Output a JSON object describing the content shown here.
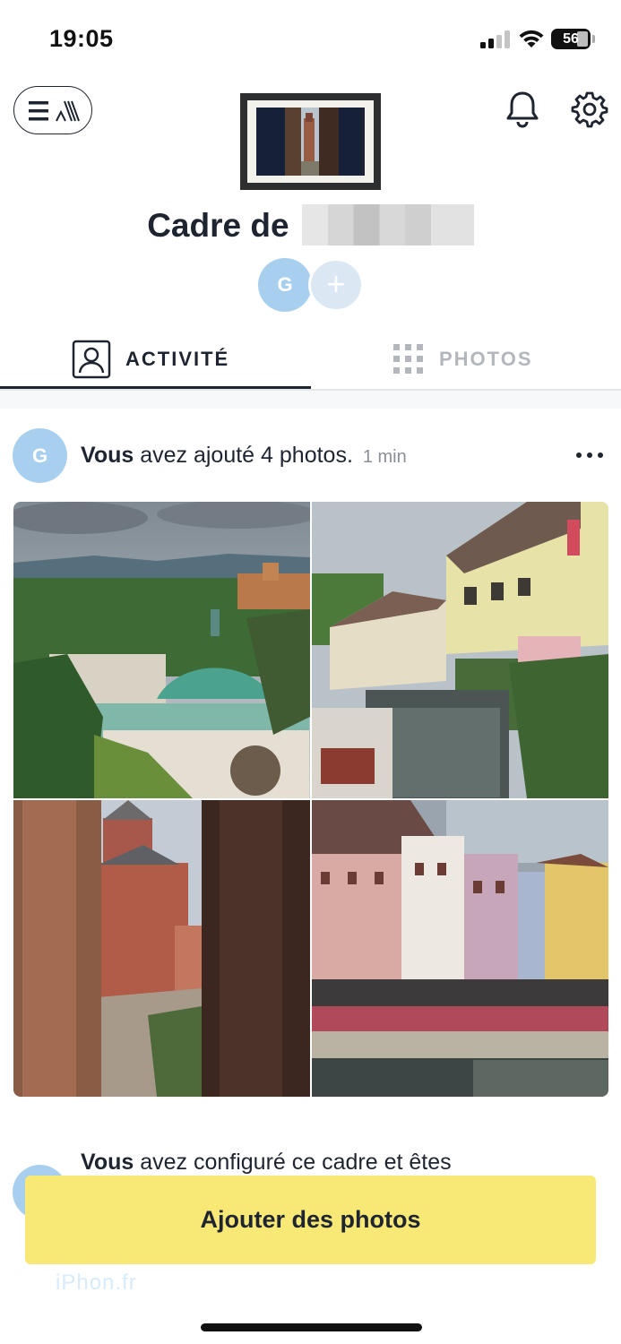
{
  "status_bar": {
    "time": "19:05",
    "battery": "56"
  },
  "header": {
    "menu_icon": "menu-logo-icon",
    "notifications_icon": "bell-icon",
    "settings_icon": "gear-icon",
    "frame_title_prefix": "Cadre de"
  },
  "members": {
    "avatar_initial": "G",
    "add_symbol": "+"
  },
  "tabs": [
    {
      "label": "ACTIVITÉ",
      "icon": "person-icon",
      "active": true
    },
    {
      "label": "PHOTOS",
      "icon": "grid-icon",
      "active": false
    }
  ],
  "feed": {
    "items": [
      {
        "avatar_initial": "G",
        "actor": "Vous",
        "action": "avez ajouté 4 photos.",
        "time": "1 min",
        "photos": [
          "Baden-Baden dome",
          "Petite Venise Colmar",
          "Haut-Koenigsbourg castle",
          "Colmar canal houses"
        ]
      },
      {
        "actor": "Vous",
        "action": "avez configuré ce cadre et êtes"
      }
    ]
  },
  "actions": {
    "add_photos_label": "Ajouter des photos"
  },
  "watermark": "iPhon.fr",
  "colors": {
    "accent_yellow": "#f8e977",
    "avatar_blue": "#a9cfee",
    "text_dark": "#1f2530",
    "tab_inactive": "#b3b7bd"
  }
}
